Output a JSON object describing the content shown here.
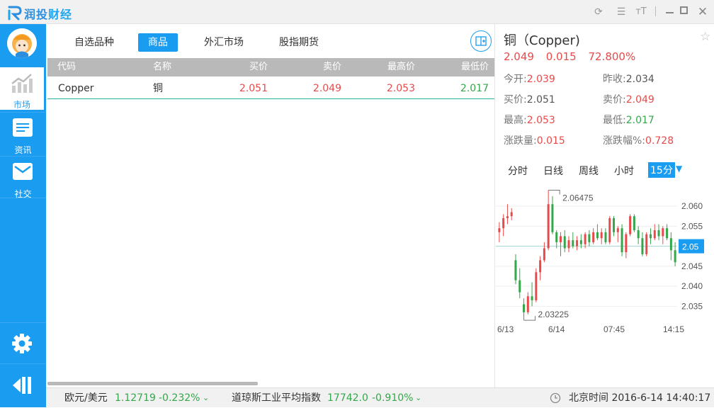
{
  "app": {
    "title_part1": "润投",
    "title_part2": "财经"
  },
  "titlebar": {
    "icons": [
      "refresh-icon",
      "menu-icon",
      "font-size-icon",
      "minimize-icon",
      "maximize-icon",
      "close-icon"
    ]
  },
  "sidebar": {
    "items": [
      {
        "label": "市场",
        "icon": "trend-chart-icon"
      },
      {
        "label": "资讯",
        "icon": "document-icon"
      },
      {
        "label": "社交",
        "icon": "mail-icon"
      }
    ],
    "settings_icon": "gear-icon",
    "exit_icon": "exit-icon"
  },
  "tabs": [
    "自选品种",
    "商品",
    "外汇市场",
    "股指期货"
  ],
  "table": {
    "headers": [
      "代码",
      "名称",
      "买价",
      "卖价",
      "最高价",
      "最低价"
    ],
    "rows": [
      {
        "code": "Copper",
        "name": "铜",
        "bid": "2.051",
        "ask": "2.049",
        "high": "2.053",
        "low": "2.017"
      }
    ]
  },
  "quote": {
    "title": "铜（Copper)",
    "price": "2.049",
    "change": "0.015",
    "change_pct": "72.800%",
    "open_label": "今开:",
    "open": "2.039",
    "prev_close_label": "昨收:",
    "prev_close": "2.034",
    "bid_label": "买价:",
    "bid": "2.051",
    "ask_label": "卖价:",
    "ask": "2.049",
    "high_label": "最高:",
    "high": "2.053",
    "low_label": "最低:",
    "low": "2.017",
    "chg_label": "涨跌量:",
    "chg": "0.015",
    "chg_pct_label": "涨跌幅%:",
    "chg_pct": "0.728"
  },
  "chart_tabs": [
    "分时",
    "日线",
    "周线",
    "小时",
    "15分"
  ],
  "chart_data": {
    "type": "candlestick",
    "y_ticks": [
      "2.060",
      "2.055",
      "2.05",
      "2.045",
      "2.040",
      "2.035"
    ],
    "x_ticks": [
      "6/13",
      "6/14",
      "07:45",
      "14:15"
    ],
    "current_price_label": "2.05",
    "max_label": "2.06475",
    "min_label": "2.03225",
    "ylim": [
      2.031,
      2.0655
    ],
    "candles": [
      [
        2.0535,
        2.056,
        2.051,
        2.0545
      ],
      [
        2.0545,
        2.058,
        2.0525,
        2.057
      ],
      [
        2.057,
        2.0605,
        2.0555,
        2.0575
      ],
      [
        2.0575,
        2.0595,
        2.0565,
        2.0585
      ],
      [
        2.0465,
        2.048,
        2.0405,
        2.0415
      ],
      [
        2.0415,
        2.0445,
        2.037,
        2.0385
      ],
      [
        2.0355,
        2.037,
        2.0315,
        2.0335
      ],
      [
        2.0335,
        2.0385,
        2.033,
        2.0375
      ],
      [
        2.0375,
        2.041,
        2.035,
        2.0365
      ],
      [
        2.0365,
        2.0445,
        2.036,
        2.0435
      ],
      [
        2.0435,
        2.0475,
        2.0415,
        2.0465
      ],
      [
        2.0465,
        2.051,
        2.046,
        2.0495
      ],
      [
        2.0495,
        2.064,
        2.049,
        2.0605
      ],
      [
        2.0605,
        2.0625,
        2.053,
        2.0535
      ],
      [
        2.0535,
        2.054,
        2.0495,
        2.051
      ],
      [
        2.051,
        2.0535,
        2.0475,
        2.0525
      ],
      [
        2.0525,
        2.054,
        2.0485,
        2.0495
      ],
      [
        2.0495,
        2.0525,
        2.0485,
        2.0515
      ],
      [
        2.0515,
        2.0535,
        2.0495,
        2.05
      ],
      [
        2.05,
        2.0525,
        2.049,
        2.0515
      ],
      [
        2.0515,
        2.053,
        2.0495,
        2.0505
      ],
      [
        2.0505,
        2.0535,
        2.0495,
        2.053
      ],
      [
        2.053,
        2.054,
        2.05,
        2.051
      ],
      [
        2.051,
        2.0545,
        2.0505,
        2.0535
      ],
      [
        2.0535,
        2.0555,
        2.0515,
        2.052
      ],
      [
        2.052,
        2.0545,
        2.0505,
        2.0535
      ],
      [
        2.0535,
        2.0545,
        2.0505,
        2.051
      ],
      [
        2.051,
        2.0575,
        2.0505,
        2.057
      ],
      [
        2.057,
        2.0575,
        2.0525,
        2.0535
      ],
      [
        2.0535,
        2.055,
        2.051,
        2.0545
      ],
      [
        2.0545,
        2.0555,
        2.0475,
        2.0485
      ],
      [
        2.0485,
        2.0535,
        2.047,
        2.053
      ],
      [
        2.053,
        2.058,
        2.0525,
        2.0575
      ],
      [
        2.0575,
        2.058,
        2.0535,
        2.054
      ],
      [
        2.054,
        2.055,
        2.0505,
        2.052
      ],
      [
        2.052,
        2.0535,
        2.0475,
        2.048
      ],
      [
        2.048,
        2.0535,
        2.0475,
        2.053
      ],
      [
        2.053,
        2.0545,
        2.0505,
        2.052
      ],
      [
        2.052,
        2.0555,
        2.0515,
        2.054
      ],
      [
        2.054,
        2.0555,
        2.0515,
        2.0525
      ],
      [
        2.0525,
        2.055,
        2.0505,
        2.0545
      ],
      [
        2.0545,
        2.0555,
        2.0515,
        2.052
      ],
      [
        2.052,
        2.0535,
        2.0465,
        2.049
      ],
      [
        2.049,
        2.051,
        2.045,
        2.046
      ]
    ],
    "up_color": "#e84a4a",
    "down_color": "#35a64a"
  },
  "footer": {
    "ticker1_name": "欧元/美元",
    "ticker1_price": "1.12719",
    "ticker1_pct": "-0.232%",
    "ticker2_name": "道琼斯工业平均指数",
    "ticker2_price": "17742.0",
    "ticker2_pct": "-0.910%",
    "clock": "北京时间 2016-6-14 14:40:17"
  }
}
